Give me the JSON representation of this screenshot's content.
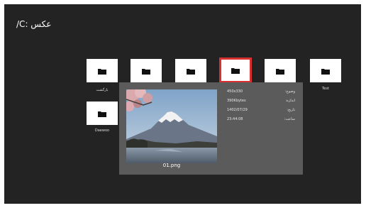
{
  "header": {
    "title": "عکس :C/"
  },
  "tiles": [
    {
      "label": "بازگشت",
      "icon": "folder-icon"
    },
    {
      "label": "",
      "icon": "folder-icon"
    },
    {
      "label": "",
      "icon": "folder-icon"
    },
    {
      "label": "",
      "icon": "folder-icon",
      "selected": true
    },
    {
      "label": "",
      "icon": "folder-icon"
    },
    {
      "label": "Test",
      "icon": "folder-icon"
    },
    {
      "label": "Daewoo",
      "icon": "folder-icon"
    }
  ],
  "preview": {
    "filename": "01.png",
    "info": [
      {
        "key": "وضوح:",
        "value": "450x330"
      },
      {
        "key": "اندازه:",
        "value": "390Kbytes"
      },
      {
        "key": "تاریخ:",
        "value": "1402/07/29"
      },
      {
        "key": "ساعت:",
        "value": "23:44:08"
      }
    ]
  },
  "colors": {
    "background": "#232323",
    "tile": "#ffffff",
    "selection": "#d93030",
    "panel": "#5b5b5b"
  }
}
